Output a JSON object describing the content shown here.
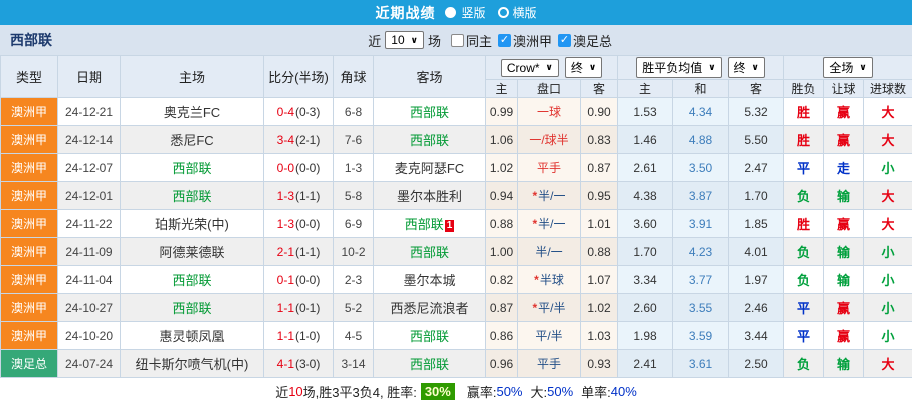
{
  "icons": {
    "caret": "∨",
    "check": "✓",
    "star": "*"
  },
  "colors": {
    "topbar_bg": "#1e9fdb",
    "league": {
      "orange": "#f6861f",
      "green": "#35a878"
    },
    "score": "#e60012",
    "handicap": {
      "red": "#e0342f",
      "navy": "#234f87"
    },
    "mean_draw": "#3d7dbb",
    "result": {
      "red": "#e60012",
      "blue": "#0031c8",
      "green": "#00a03c"
    },
    "footer_badge_bg": "#2f9b00",
    "footer_badge_text": "#ffffcc",
    "footer_value": "#0031c8",
    "footer_count": "#e60012"
  },
  "topbar": {
    "title": "近期战绩",
    "layout_options": [
      {
        "label": "竖版",
        "selected": true
      },
      {
        "label": "横版",
        "selected": false
      }
    ]
  },
  "filterbar": {
    "team": "西部联",
    "recent_prefix": "近",
    "recent_count": "10",
    "recent_suffix": "场",
    "checkboxes": [
      {
        "label": "同主",
        "checked": false
      },
      {
        "label": "澳洲甲",
        "checked": true
      },
      {
        "label": "澳足总",
        "checked": true
      }
    ]
  },
  "table": {
    "headers": [
      "类型",
      "日期",
      "主场",
      "比分(半场)",
      "角球",
      "客场"
    ],
    "dropdowns": {
      "company": "Crow*",
      "time1": "终",
      "mean": "胜平负均值",
      "time2": "终",
      "scope": "全场"
    },
    "sub_headers": [
      "主",
      "盘口",
      "客",
      "主",
      "和",
      "客",
      "胜负",
      "让球",
      "进球数"
    ],
    "rows": [
      {
        "league": "澳洲甲",
        "league_color": "orange",
        "date": "24-12-21",
        "home": "奥克兰FC",
        "home_self": false,
        "score": "0-4",
        "half": "(0-3)",
        "corners": "6-8",
        "away": "西部联",
        "away_self": true,
        "away_badge": "",
        "odds_home": "0.99",
        "handicap": "一球",
        "handicap_color": "red",
        "handicap_star": false,
        "odds_away": "0.90",
        "avg_home": "1.53",
        "avg_draw": "4.34",
        "avg_away": "5.32",
        "result": "胜",
        "result_color": "red",
        "cover": "赢",
        "cover_color": "red",
        "totals": "大",
        "totals_color": "red"
      },
      {
        "league": "澳洲甲",
        "league_color": "orange",
        "date": "24-12-14",
        "home": "悉尼FC",
        "home_self": false,
        "score": "3-4",
        "half": "(2-1)",
        "corners": "7-6",
        "away": "西部联",
        "away_self": true,
        "away_badge": "",
        "odds_home": "1.06",
        "handicap": "一/球半",
        "handicap_color": "red",
        "handicap_star": false,
        "odds_away": "0.83",
        "avg_home": "1.46",
        "avg_draw": "4.88",
        "avg_away": "5.50",
        "result": "胜",
        "result_color": "red",
        "cover": "赢",
        "cover_color": "red",
        "totals": "大",
        "totals_color": "red"
      },
      {
        "league": "澳洲甲",
        "league_color": "orange",
        "date": "24-12-07",
        "home": "西部联",
        "home_self": true,
        "score": "0-0",
        "half": "(0-0)",
        "corners": "1-3",
        "away": "麦克阿瑟FC",
        "away_self": false,
        "away_badge": "",
        "odds_home": "1.02",
        "handicap": "平手",
        "handicap_color": "red",
        "handicap_star": false,
        "odds_away": "0.87",
        "avg_home": "2.61",
        "avg_draw": "3.50",
        "avg_away": "2.47",
        "result": "平",
        "result_color": "blue",
        "cover": "走",
        "cover_color": "blue",
        "totals": "小",
        "totals_color": "green"
      },
      {
        "league": "澳洲甲",
        "league_color": "orange",
        "date": "24-12-01",
        "home": "西部联",
        "home_self": true,
        "score": "1-3",
        "half": "(1-1)",
        "corners": "5-8",
        "away": "墨尔本胜利",
        "away_self": false,
        "away_badge": "",
        "odds_home": "0.94",
        "handicap": "半/一",
        "handicap_color": "navy",
        "handicap_star": true,
        "odds_away": "0.95",
        "avg_home": "4.38",
        "avg_draw": "3.87",
        "avg_away": "1.70",
        "result": "负",
        "result_color": "green",
        "cover": "输",
        "cover_color": "green",
        "totals": "大",
        "totals_color": "red"
      },
      {
        "league": "澳洲甲",
        "league_color": "orange",
        "date": "24-11-22",
        "home": "珀斯光荣(中)",
        "home_self": false,
        "score": "1-3",
        "half": "(0-0)",
        "corners": "6-9",
        "away": "西部联",
        "away_self": true,
        "away_badge": "1",
        "odds_home": "0.88",
        "handicap": "半/一",
        "handicap_color": "navy",
        "handicap_star": true,
        "odds_away": "1.01",
        "avg_home": "3.60",
        "avg_draw": "3.91",
        "avg_away": "1.85",
        "result": "胜",
        "result_color": "red",
        "cover": "赢",
        "cover_color": "red",
        "totals": "大",
        "totals_color": "red"
      },
      {
        "league": "澳洲甲",
        "league_color": "orange",
        "date": "24-11-09",
        "home": "阿德莱德联",
        "home_self": false,
        "score": "2-1",
        "half": "(1-1)",
        "corners": "10-2",
        "away": "西部联",
        "away_self": true,
        "away_badge": "",
        "odds_home": "1.00",
        "handicap": "半/一",
        "handicap_color": "navy",
        "handicap_star": false,
        "odds_away": "0.88",
        "avg_home": "1.70",
        "avg_draw": "4.23",
        "avg_away": "4.01",
        "result": "负",
        "result_color": "green",
        "cover": "输",
        "cover_color": "green",
        "totals": "小",
        "totals_color": "green"
      },
      {
        "league": "澳洲甲",
        "league_color": "orange",
        "date": "24-11-04",
        "home": "西部联",
        "home_self": true,
        "score": "0-1",
        "half": "(0-0)",
        "corners": "2-3",
        "away": "墨尔本城",
        "away_self": false,
        "away_badge": "",
        "odds_home": "0.82",
        "handicap": "半球",
        "handicap_color": "navy",
        "handicap_star": true,
        "odds_away": "1.07",
        "avg_home": "3.34",
        "avg_draw": "3.77",
        "avg_away": "1.97",
        "result": "负",
        "result_color": "green",
        "cover": "输",
        "cover_color": "green",
        "totals": "小",
        "totals_color": "green"
      },
      {
        "league": "澳洲甲",
        "league_color": "orange",
        "date": "24-10-27",
        "home": "西部联",
        "home_self": true,
        "score": "1-1",
        "half": "(0-1)",
        "corners": "5-2",
        "away": "西悉尼流浪者",
        "away_self": false,
        "away_badge": "",
        "odds_home": "0.87",
        "handicap": "平/半",
        "handicap_color": "navy",
        "handicap_star": true,
        "odds_away": "1.02",
        "avg_home": "2.60",
        "avg_draw": "3.55",
        "avg_away": "2.46",
        "result": "平",
        "result_color": "blue",
        "cover": "赢",
        "cover_color": "red",
        "totals": "小",
        "totals_color": "green"
      },
      {
        "league": "澳洲甲",
        "league_color": "orange",
        "date": "24-10-20",
        "home": "惠灵顿凤凰",
        "home_self": false,
        "score": "1-1",
        "half": "(1-0)",
        "corners": "4-5",
        "away": "西部联",
        "away_self": true,
        "away_badge": "",
        "odds_home": "0.86",
        "handicap": "平/半",
        "handicap_color": "navy",
        "handicap_star": false,
        "odds_away": "1.03",
        "avg_home": "1.98",
        "avg_draw": "3.59",
        "avg_away": "3.44",
        "result": "平",
        "result_color": "blue",
        "cover": "赢",
        "cover_color": "red",
        "totals": "小",
        "totals_color": "green"
      },
      {
        "league": "澳足总",
        "league_color": "green",
        "date": "24-07-24",
        "home": "纽卡斯尔喷气机(中)",
        "home_self": false,
        "score": "4-1",
        "half": "(3-0)",
        "corners": "3-14",
        "away": "西部联",
        "away_self": true,
        "away_badge": "",
        "odds_home": "0.96",
        "handicap": "平手",
        "handicap_color": "navy",
        "handicap_star": false,
        "odds_away": "0.93",
        "avg_home": "2.41",
        "avg_draw": "3.61",
        "avg_away": "2.50",
        "result": "负",
        "result_color": "green",
        "cover": "输",
        "cover_color": "green",
        "totals": "大",
        "totals_color": "red"
      }
    ]
  },
  "footer": {
    "prefix": "近",
    "count": "10",
    "mid": "场,胜3平3负4, 胜率:",
    "win_rate": "30%",
    "rates": [
      {
        "label": "赢率:",
        "value": "50%"
      },
      {
        "label": "大:",
        "value": "50%"
      },
      {
        "label": "单率:",
        "value": "40%"
      }
    ]
  }
}
